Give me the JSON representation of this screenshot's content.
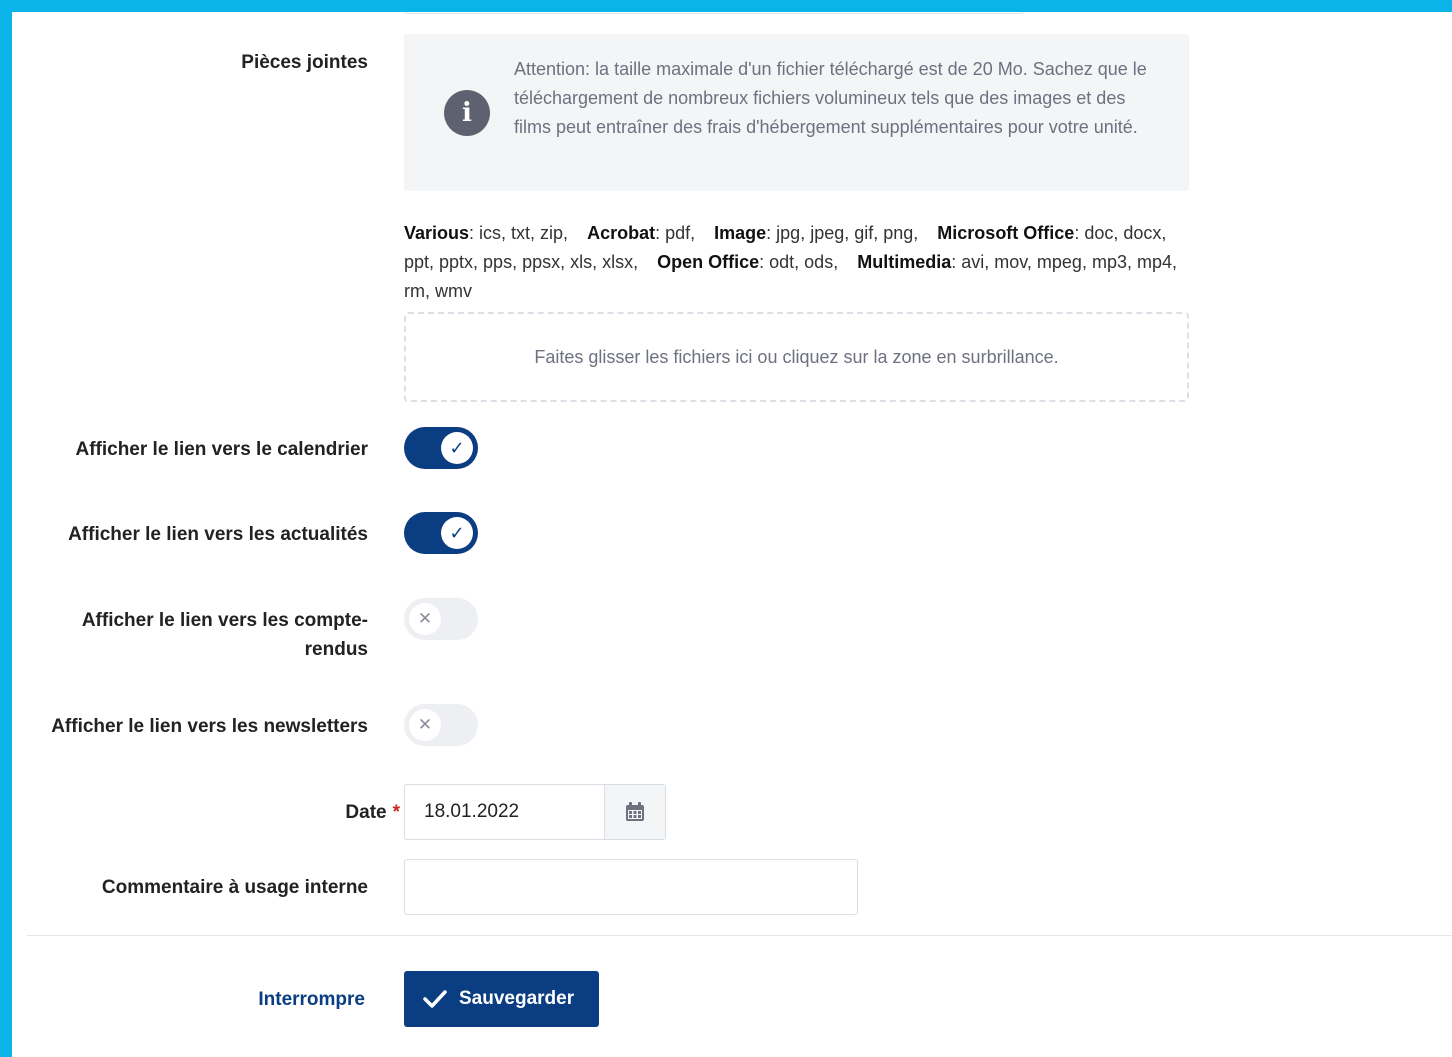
{
  "attachments": {
    "label": "Pièces jointes",
    "info_icon": "info-icon",
    "info_text": "Attention: la taille maximale d'un fichier téléchargé est de 20 Mo. Sachez que le téléchargement de nombreux fichiers volumineux tels que des images et des films peut entraîner des frais d'hébergement supplémentaires pour votre unité.",
    "formats": [
      {
        "name": "Various",
        "types": ": ics, txt, zip,"
      },
      {
        "name": "Acrobat",
        "types": ": pdf,"
      },
      {
        "name": "Image",
        "types": ": jpg, jpeg, gif, png,"
      },
      {
        "name": "Microsoft Office",
        "types": ": doc, docx, ppt, pptx, pps, ppsx, xls, xlsx,"
      },
      {
        "name": "Open Office",
        "types": ": odt, ods,"
      },
      {
        "name": "Multimedia",
        "types": ": avi, mov, mpeg, mp3, mp4, rm, wmv"
      }
    ],
    "dropzone_text": "Faites glisser les fichiers ici ou cliquez sur la zone en surbrillance."
  },
  "toggles": [
    {
      "label": "Afficher le lien vers le calendrier",
      "checked": true
    },
    {
      "label": "Afficher le lien vers les actualités",
      "checked": true
    },
    {
      "label": "Afficher le lien vers les compte-rendus",
      "checked": false
    },
    {
      "label": "Afficher le lien vers les newsletters",
      "checked": false
    }
  ],
  "date": {
    "label": "Date",
    "required_marker": "*",
    "value": "18.01.2022",
    "icon": "calendar-icon"
  },
  "comment": {
    "label": "Commentaire à usage interne",
    "value": ""
  },
  "actions": {
    "cancel_label": "Interrompre",
    "save_label": "Sauvegarder",
    "save_icon": "check-icon"
  },
  "colors": {
    "frame": "#0ab4e8",
    "primary": "#0a3d82",
    "required": "#c62828"
  }
}
